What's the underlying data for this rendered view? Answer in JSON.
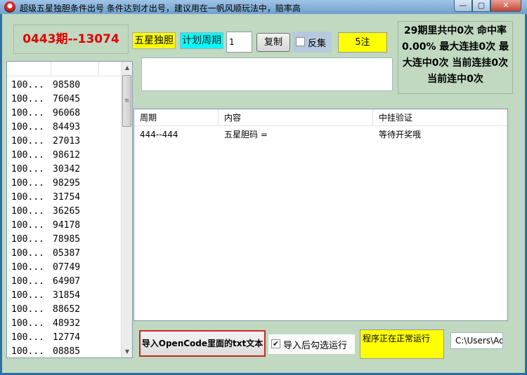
{
  "window": {
    "title": "超级五星独胆条件出号 条件达到才出号，建议用在一帆风顺玩法中，赔率高",
    "buttons": [
      "—",
      "▢",
      "✕"
    ]
  },
  "toolbar": {
    "period_display": "0443期--13074",
    "label_five_star": "五星独胆",
    "label_plan_period": "计划周期",
    "period_input_value": "1",
    "copy_button": "复制",
    "reverse_label": "反集",
    "reverse_checked": false,
    "count_display": "5注"
  },
  "stats": {
    "text": "29期里共中0次 命中率0.00% 最大连挂0次 最大连中0次 当前连挂0次 当前连中0次"
  },
  "left_list": {
    "rows": [
      {
        "id": "100...",
        "num": "98580"
      },
      {
        "id": "100...",
        "num": "76045"
      },
      {
        "id": "100...",
        "num": "96068"
      },
      {
        "id": "100...",
        "num": "84493"
      },
      {
        "id": "100...",
        "num": "27013"
      },
      {
        "id": "100...",
        "num": "98612"
      },
      {
        "id": "100...",
        "num": "30342"
      },
      {
        "id": "100...",
        "num": "98295"
      },
      {
        "id": "100...",
        "num": "31754"
      },
      {
        "id": "100...",
        "num": "36265"
      },
      {
        "id": "100...",
        "num": "94178"
      },
      {
        "id": "100...",
        "num": "78985"
      },
      {
        "id": "100...",
        "num": "05387"
      },
      {
        "id": "100...",
        "num": "07749"
      },
      {
        "id": "100...",
        "num": "64907"
      },
      {
        "id": "100...",
        "num": "31854"
      },
      {
        "id": "100...",
        "num": "88652"
      },
      {
        "id": "100...",
        "num": "48932"
      },
      {
        "id": "100...",
        "num": "12774"
      },
      {
        "id": "100...",
        "num": "08885"
      }
    ]
  },
  "results": {
    "headers": [
      "周期",
      "内容",
      "中挂验证"
    ],
    "rows": [
      {
        "period": "444--444",
        "content": "五星胆码 =",
        "verify": "等待开奖哦"
      }
    ]
  },
  "footer": {
    "import_button": "导入OpenCode里面的txt文本",
    "import_check_label": "导入后勾选运行",
    "import_checked": true,
    "status_text": "程序正在正常运行",
    "path_text": "C:\\Users\\Ad"
  }
}
